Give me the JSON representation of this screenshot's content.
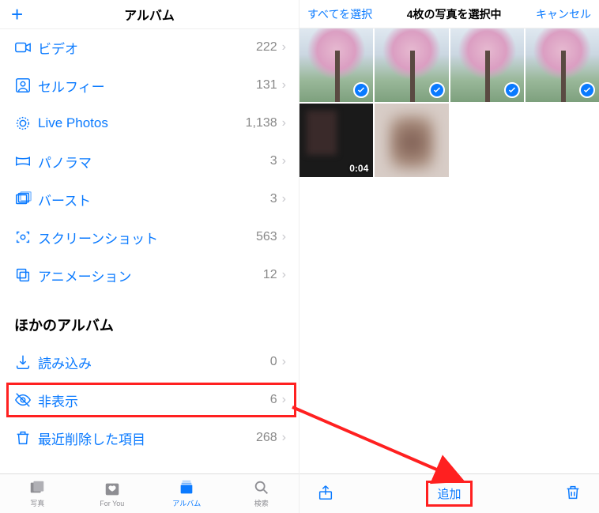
{
  "left": {
    "header": {
      "title": "アルバム"
    },
    "media_types": [
      {
        "icon": "video",
        "label": "ビデオ",
        "count": "222"
      },
      {
        "icon": "selfie",
        "label": "セルフィー",
        "count": "131"
      },
      {
        "icon": "live",
        "label": "Live Photos",
        "count": "1,138"
      },
      {
        "icon": "pano",
        "label": "パノラマ",
        "count": "3"
      },
      {
        "icon": "burst",
        "label": "バースト",
        "count": "3"
      },
      {
        "icon": "screenshot",
        "label": "スクリーンショット",
        "count": "563"
      },
      {
        "icon": "animation",
        "label": "アニメーション",
        "count": "12"
      }
    ],
    "other_section_title": "ほかのアルバム",
    "other_albums": [
      {
        "icon": "import",
        "label": "読み込み",
        "count": "0"
      },
      {
        "icon": "hidden",
        "label": "非表示",
        "count": "6",
        "highlight": true
      },
      {
        "icon": "trash",
        "label": "最近削除した項目",
        "count": "268"
      }
    ],
    "tabs": [
      {
        "icon": "photos",
        "label": "写真"
      },
      {
        "icon": "foryou",
        "label": "For You"
      },
      {
        "icon": "albums",
        "label": "アルバム",
        "active": true
      },
      {
        "icon": "search",
        "label": "検索"
      }
    ]
  },
  "right": {
    "header": {
      "select_all": "すべてを選択",
      "selecting": "4枚の写真を選択中",
      "cancel": "キャンセル"
    },
    "thumbs": [
      {
        "kind": "cherry",
        "selected": true
      },
      {
        "kind": "cherry",
        "selected": true
      },
      {
        "kind": "cherry",
        "selected": true
      },
      {
        "kind": "cherry",
        "selected": true
      },
      {
        "kind": "dark",
        "duration": "0:04"
      },
      {
        "kind": "blurred"
      }
    ],
    "toolbar": {
      "add": "追加"
    }
  }
}
